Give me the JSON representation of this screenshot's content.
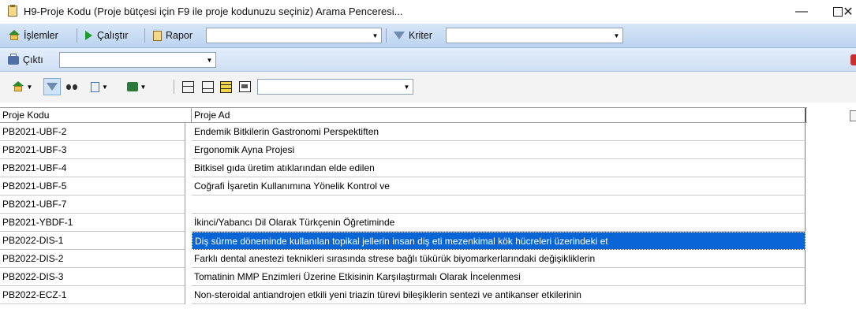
{
  "window": {
    "title": "H9-Proje Kodu (Proje bütçesi için F9 ile proje kodunuzu seçiniz) Arama Penceresi...",
    "minimize": "—",
    "close": "✕"
  },
  "toolbar1": {
    "islemler": "İşlemler",
    "calistir": "Çalıştır",
    "rapor": "Rapor",
    "rapor_value": "",
    "kriter": "Kriter",
    "kriter_value": ""
  },
  "toolbar2": {
    "cikti": "Çıktı",
    "cikti_value": ""
  },
  "toolbar3": {
    "combo_value": ""
  },
  "grid": {
    "headers": [
      "Proje Kodu",
      "Proje Ad"
    ],
    "rows": [
      {
        "kod": "PB2021-UBF-2",
        "ad": "Endemik Bitkilerin Gastronomi Perspektiften"
      },
      {
        "kod": "PB2021-UBF-3",
        "ad": "Ergonomik Ayna Projesi"
      },
      {
        "kod": "PB2021-UBF-4",
        "ad": "Bitkisel gıda üretim atıklarından elde edilen"
      },
      {
        "kod": "PB2021-UBF-5",
        "ad": "Coğrafi İşaretin Kullanımına Yönelik Kontrol ve"
      },
      {
        "kod": "PB2021-UBF-7",
        "ad": ""
      },
      {
        "kod": "PB2021-YBDF-1",
        "ad": "İkinci/Yabancı Dil Olarak Türkçenin Öğretiminde"
      },
      {
        "kod": "PB2022-DIS-1",
        "ad": "Diş sürme döneminde kullanılan topikal jellerin insan diş eti mezenkimal kök hücreleri üzerindeki et"
      },
      {
        "kod": "PB2022-DIS-2",
        "ad": "Farklı dental anestezi teknikleri sırasında strese bağlı tükürük biyomarkerlarındaki değişikliklerin"
      },
      {
        "kod": "PB2022-DIS-3",
        "ad": "Tomatinin MMP Enzimleri Üzerine Etkisinin Karşılaştırmalı Olarak İncelenmesi"
      },
      {
        "kod": "PB2022-ECZ-1",
        "ad": "Non-steroidal antiandrojen etkili yeni triazin türevi bileşiklerin sentezi ve antikanser etkilerinin"
      }
    ],
    "selected_index": 6
  },
  "colors": {
    "selection": "#0a66d6",
    "toolbar_bg": "#c8dbf3"
  }
}
